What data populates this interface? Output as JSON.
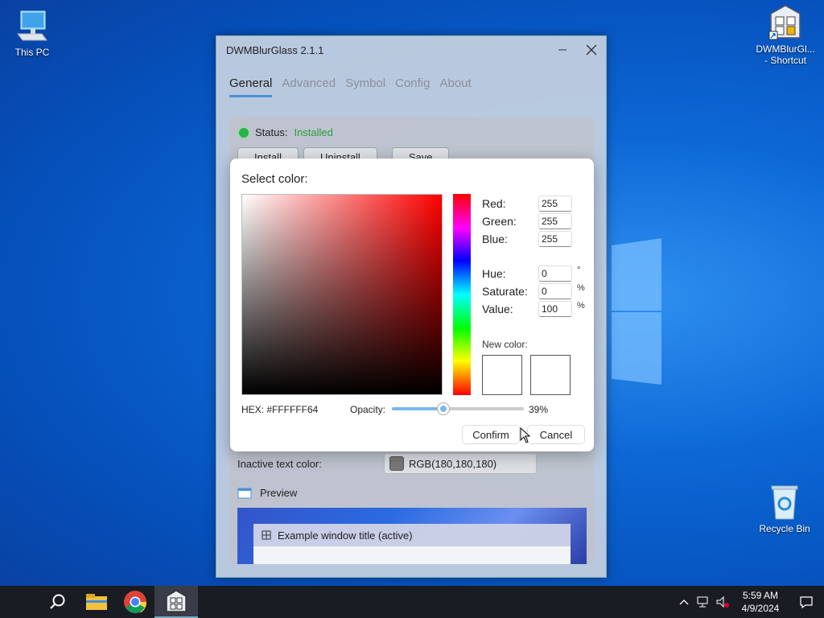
{
  "desktop": {
    "icons": [
      {
        "label": "This PC"
      },
      {
        "label": "DWMBlurGl... - Shortcut"
      },
      {
        "label": "Recycle Bin"
      }
    ]
  },
  "app": {
    "title": "DWMBlurGlass 2.1.1",
    "tabs": [
      {
        "label": "General"
      },
      {
        "label": "Advanced"
      },
      {
        "label": "Symbol"
      },
      {
        "label": "Config"
      },
      {
        "label": "About"
      }
    ],
    "status_label": "Status:",
    "status_value": "Installed",
    "buttons": {
      "install": "Install",
      "uninstall": "Uninstall",
      "save": "Save"
    },
    "inactive_text_label": "Inactive text color:",
    "inactive_text_value": "RGB(180,180,180)",
    "preview_label": "Preview",
    "example_window_title": "Example window title (active)"
  },
  "dialog": {
    "title": "Select color:",
    "fields": {
      "red_label": "Red:",
      "red": "255",
      "green_label": "Green:",
      "green": "255",
      "blue_label": "Blue:",
      "blue": "255",
      "hue_label": "Hue:",
      "hue": "0",
      "hue_unit": "°",
      "saturate_label": "Saturate:",
      "saturate": "0",
      "saturate_unit": "%",
      "value_label": "Value:",
      "value": "100",
      "value_unit": "%"
    },
    "new_color_label": "New color:",
    "hex": "HEX: #FFFFFF64",
    "opacity_label": "Opacity:",
    "opacity_value": "39%",
    "opacity_fraction": 0.39,
    "confirm": "Confirm",
    "cancel": "Cancel"
  },
  "taskbar": {
    "time": "5:59 AM",
    "date": "4/9/2024"
  },
  "colors": {
    "accent": "#4a90d9",
    "status_green": "#2a9d3c",
    "taskbar": "#1a1c23"
  }
}
